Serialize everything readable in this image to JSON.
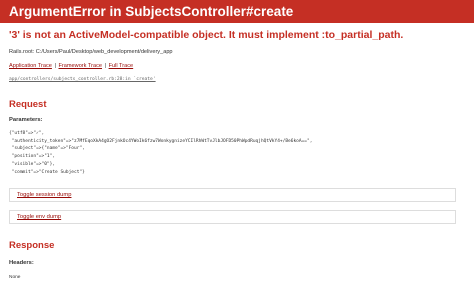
{
  "header": {
    "title": "ArgumentError in SubjectsController#create"
  },
  "error": {
    "message": "'3' is not an ActiveModel-compatible object. It must implement :to_partial_path.",
    "rails_root": "Rails.root: C:/Users/Paul/Desktop/web_development/delivery_app"
  },
  "traces": {
    "links": [
      "Application Trace",
      "Framework Trace",
      "Full Trace"
    ],
    "separator": "|",
    "first_line": "app/controllers/subjects_controller.rb:28:in `create'"
  },
  "request": {
    "heading": "Request",
    "parameters_label": "Parameters:",
    "parameters_text": "{\"utf8\"=>\"✓\",\n \"authenticity_token\"=>\"z7MfEqoXkA4gO2FjnkOc4YWoIk6fzw7WonkygnizeYCIlRhWtTvJlbJOFD50PhWpdRuqjhQtVkY4+/Be6koA==\",\n \"subject\"=>{\"name\"=>\"Four\",\n \"position\"=>\"1\",\n \"visible\"=>\"0\"},\n \"commit\"=>\"Create Subject\"}",
    "toggle_session": "Toggle session dump",
    "toggle_env": "Toggle env dump"
  },
  "response": {
    "heading": "Response",
    "headers_label": "Headers:",
    "headers_value": "None"
  },
  "colors": {
    "header_bg": "#c52f24",
    "error_text": "#c52f24",
    "link": "#980905"
  }
}
